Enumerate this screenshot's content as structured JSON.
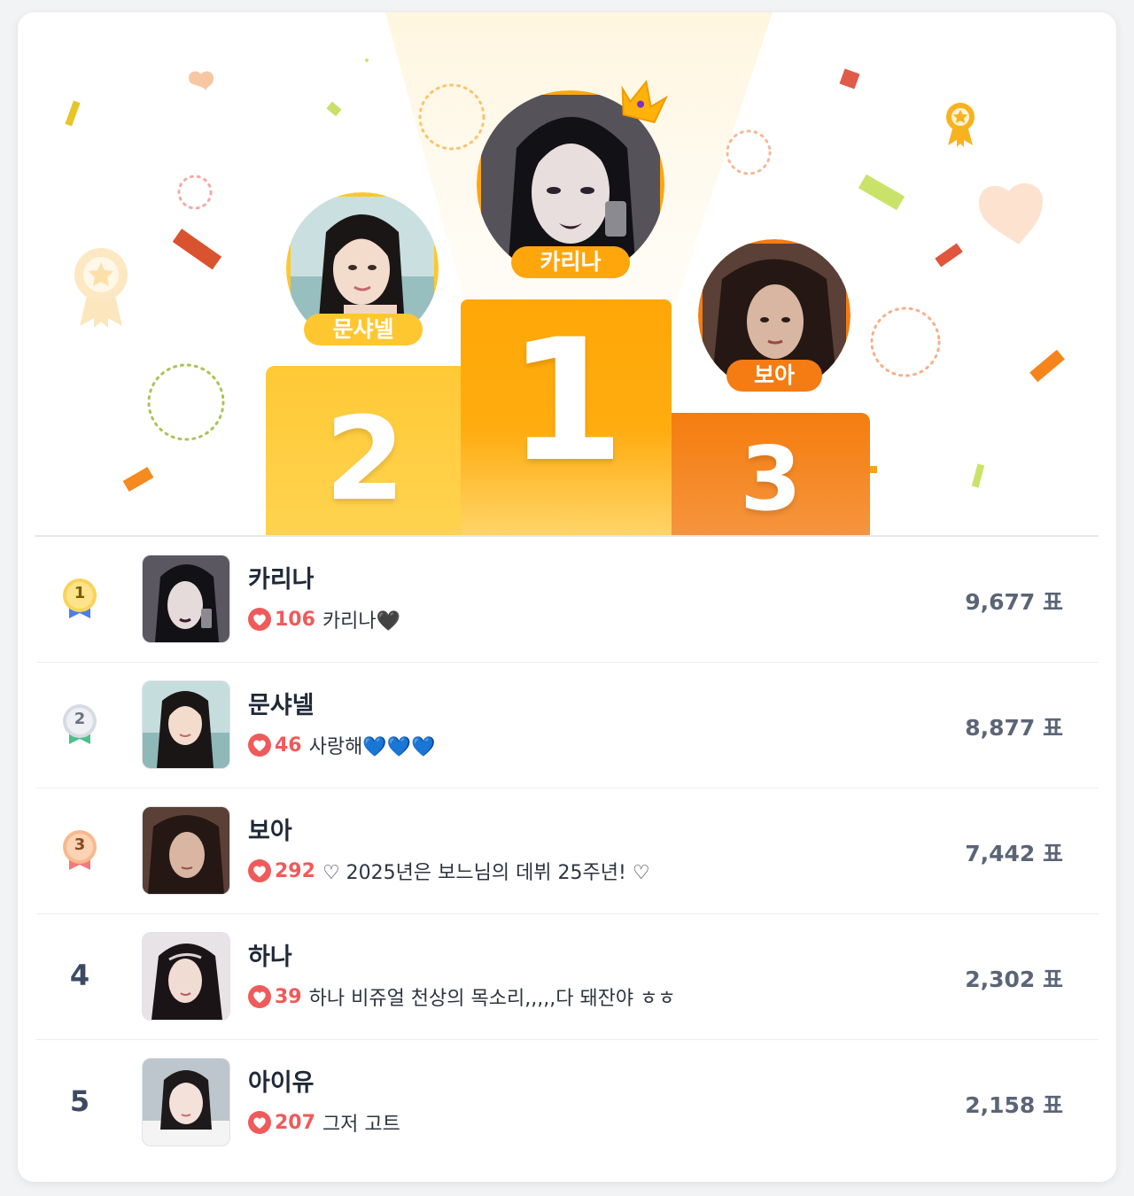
{
  "podium": {
    "first": {
      "name": "카리나",
      "rank": "1"
    },
    "second": {
      "name": "문샤넬",
      "rank": "2"
    },
    "third": {
      "name": "보아",
      "rank": "3"
    }
  },
  "ranking": [
    {
      "rank": "1",
      "name": "카리나",
      "likes": "106",
      "message": "카리나🖤",
      "votes": "9,677 표"
    },
    {
      "rank": "2",
      "name": "문샤넬",
      "likes": "46",
      "message": "사랑해💙💙💙",
      "votes": "8,877 표"
    },
    {
      "rank": "3",
      "name": "보아",
      "likes": "292",
      "message": "♡ 2025년은 보느님의 데뷔 25주년! ♡",
      "votes": "7,442 표"
    },
    {
      "rank": "4",
      "name": "하나",
      "likes": "39",
      "message": "하나 비쥬얼 천상의 목소리,,,,,다 돼잔야 ㅎㅎ",
      "votes": "2,302 표"
    },
    {
      "rank": "5",
      "name": "아이유",
      "likes": "207",
      "message": "그저 고트",
      "votes": "2,158 표"
    }
  ],
  "colors": {
    "gold": "#ffa707",
    "silver_block": "#ffc935",
    "bronze_block": "#f57d0e",
    "like_red": "#f05a5a"
  },
  "icons": [
    "crown-icon",
    "medal-gold-icon",
    "medal-silver-icon",
    "medal-bronze-icon",
    "heart-icon"
  ]
}
